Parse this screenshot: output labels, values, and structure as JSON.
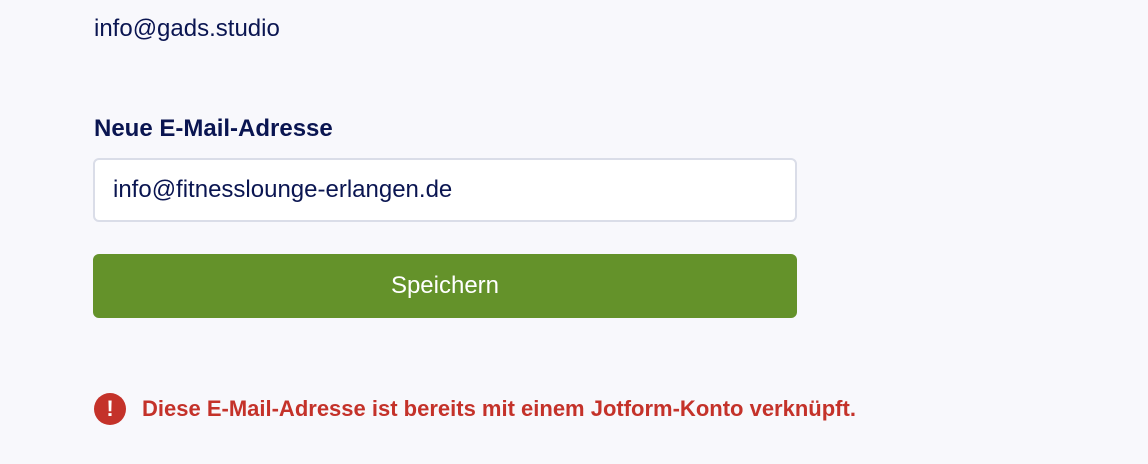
{
  "current_email": "info@gads.studio",
  "form": {
    "new_email_label": "Neue E-Mail-Adresse",
    "new_email_value": "info@fitnesslounge-erlangen.de",
    "save_label": "Speichern"
  },
  "error": {
    "icon": "exclamation-circle-icon",
    "message": "Diese E-Mail-Adresse ist bereits mit einem Jotform-Konto verknüpft."
  },
  "colors": {
    "background": "#f8f8fc",
    "text": "#0a1551",
    "button": "#64922a",
    "error": "#c4322a"
  }
}
